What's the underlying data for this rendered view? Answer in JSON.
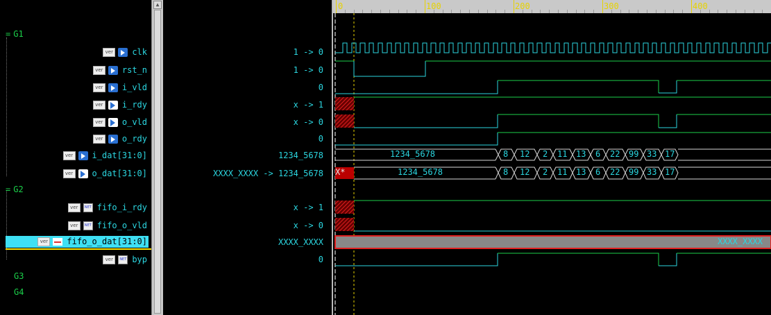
{
  "groups": [
    "G1",
    "G2",
    "G3",
    "G4"
  ],
  "ver_label": "ver",
  "signals": [
    {
      "name": "clk",
      "icon": "input-port-icon",
      "value": "1 -> 0"
    },
    {
      "name": "rst_n",
      "icon": "input-port-icon",
      "value": "1 -> 0"
    },
    {
      "name": "i_vld",
      "icon": "input-port-icon",
      "value": "0"
    },
    {
      "name": "i_rdy",
      "icon": "output-port-icon",
      "value": "x -> 1"
    },
    {
      "name": "o_vld",
      "icon": "output-port-icon",
      "value": "x -> 0"
    },
    {
      "name": "o_rdy",
      "icon": "input-port-icon",
      "value": "0"
    },
    {
      "name": "i_dat[31:0]",
      "icon": "input-port-icon",
      "value": "1234_5678"
    },
    {
      "name": "o_dat[31:0]",
      "icon": "output-port-icon",
      "value": "XXXX_XXXX -> 1234_5678"
    },
    {
      "name": "fifo_i_rdy",
      "icon": "net-icon",
      "value": "x -> 1"
    },
    {
      "name": "fifo_o_vld",
      "icon": "net-icon",
      "value": "x -> 0"
    },
    {
      "name": "fifo_o_dat[31:0]",
      "icon": "register-icon",
      "value": "XXXX_XXXX"
    },
    {
      "name": "byp",
      "icon": "net-icon",
      "value": "0"
    }
  ],
  "ruler": {
    "labels": [
      "0",
      "100",
      "200",
      "300",
      "400"
    ]
  },
  "waves": {
    "i_dat_first": "1234_5678",
    "o_dat_first": "1234_5678",
    "o_dat_unknown": "X*",
    "fifo_o_dat": "XXXX_XXXX",
    "bus_values": [
      "8",
      "12",
      "2",
      "11",
      "13",
      "6",
      "22",
      "99",
      "33",
      "17"
    ]
  },
  "colors": {
    "signal_text": "#2bd6e0",
    "group_text": "#1bd14a",
    "wave_green": "#1bd14a",
    "wave_cyan": "#2bd6e0",
    "unknown_red": "#e02020",
    "cursor_yellow": "#e6d200",
    "selection": "#3ee0f4"
  }
}
